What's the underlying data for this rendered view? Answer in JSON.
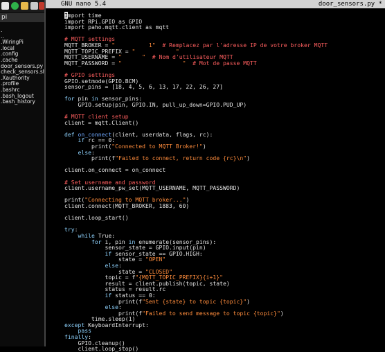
{
  "file_manager": {
    "location": "pi",
    "files": [
      ".",
      "..",
      ".WiringPi",
      ".local",
      ".config",
      ".cache",
      "door_sensors.py",
      "check_sensors.sh",
      ".Xauthority",
      ".profile",
      ".bashrc",
      ".bash_logout",
      ".bash_history"
    ]
  },
  "nano": {
    "version": "GNU nano 5.4",
    "filename": "door_sensors.py *"
  },
  "code_lines": [
    [
      [
        "t",
        "I"
      ],
      [
        "t",
        "mport time"
      ]
    ],
    [
      [
        "t",
        "import RPi.GPIO as GPIO"
      ]
    ],
    [
      [
        "t",
        "import paho.mqtt.client as mqtt"
      ]
    ],
    [
      [
        "t",
        ""
      ]
    ],
    [
      [
        "cm",
        "# MQTT settings"
      ]
    ],
    [
      [
        "t",
        "MQTT_BROKER = "
      ],
      [
        "st",
        "\""
      ],
      [
        "red",
        "          "
      ],
      [
        "st",
        "1\""
      ],
      [
        "cm",
        "  # Remplacez par l'adresse IP de votre broker MQTT"
      ]
    ],
    [
      [
        "t",
        "MQTT_TOPIC_PREFIX = "
      ],
      [
        "st",
        "\""
      ],
      [
        "red",
        "            "
      ],
      [
        "st",
        "\""
      ]
    ],
    [
      [
        "t",
        "MQTT_USERNAME = "
      ],
      [
        "st",
        "\""
      ],
      [
        "red",
        "      "
      ],
      [
        "st",
        "\""
      ],
      [
        "cm",
        "  # Nom d'utilisateur MQTT"
      ]
    ],
    [
      [
        "t",
        "MQTT_PASSWORD = "
      ],
      [
        "st",
        "\""
      ],
      [
        "red",
        "                  "
      ],
      [
        "st",
        "\""
      ],
      [
        "cm",
        "  # Mot de passe MQTT"
      ]
    ],
    [
      [
        "t",
        ""
      ]
    ],
    [
      [
        "cm",
        "# GPIO settings"
      ]
    ],
    [
      [
        "t",
        "GPIO.setmode(GPIO.BCM)"
      ]
    ],
    [
      [
        "t",
        "sensor_pins = [18, 4, 5, 6, 13, 17, 22, 26, 27]"
      ]
    ],
    [
      [
        "t",
        ""
      ]
    ],
    [
      [
        "kw",
        "for"
      ],
      [
        "t",
        " pin "
      ],
      [
        "kw",
        "in"
      ],
      [
        "t",
        " sensor_pins:"
      ]
    ],
    [
      [
        "t",
        "    GPIO.setup(pin, GPIO.IN, pull_up_down=GPIO.PUD_UP)"
      ]
    ],
    [
      [
        "t",
        ""
      ]
    ],
    [
      [
        "cm",
        "# MQTT client setup"
      ]
    ],
    [
      [
        "t",
        "client = mqtt.Client()"
      ]
    ],
    [
      [
        "t",
        ""
      ]
    ],
    [
      [
        "kw",
        "def"
      ],
      [
        "t",
        " "
      ],
      [
        "fn",
        "on_connect"
      ],
      [
        "t",
        "(client, userdata, flags, rc):"
      ]
    ],
    [
      [
        "t",
        "    "
      ],
      [
        "kw",
        "if"
      ],
      [
        "t",
        " rc == 0:"
      ]
    ],
    [
      [
        "t",
        "        print("
      ],
      [
        "st",
        "\"Connected to MQTT Broker!\""
      ],
      [
        "t",
        ")"
      ]
    ],
    [
      [
        "t",
        "    "
      ],
      [
        "kw",
        "else"
      ],
      [
        "t",
        ":"
      ]
    ],
    [
      [
        "t",
        "        print(f"
      ],
      [
        "st",
        "\"Failed to connect, return code {rc}\\n\""
      ],
      [
        "t",
        ")"
      ]
    ],
    [
      [
        "t",
        ""
      ]
    ],
    [
      [
        "t",
        "client.on_connect = on_connect"
      ]
    ],
    [
      [
        "t",
        ""
      ]
    ],
    [
      [
        "cm",
        "# Set username and password"
      ]
    ],
    [
      [
        "t",
        "client.username_pw_set(MQTT_USERNAME, MQTT_PASSWORD)"
      ]
    ],
    [
      [
        "t",
        ""
      ]
    ],
    [
      [
        "t",
        "print("
      ],
      [
        "st",
        "\"Connecting to MQTT broker...\""
      ],
      [
        "t",
        ")"
      ]
    ],
    [
      [
        "t",
        "client.connect(MQTT_BROKER, 1883, 60)"
      ]
    ],
    [
      [
        "t",
        ""
      ]
    ],
    [
      [
        "t",
        "client.loop_start()"
      ]
    ],
    [
      [
        "t",
        ""
      ]
    ],
    [
      [
        "kw",
        "try"
      ],
      [
        "t",
        ":"
      ]
    ],
    [
      [
        "t",
        "    "
      ],
      [
        "kw",
        "while"
      ],
      [
        "t",
        " True:"
      ]
    ],
    [
      [
        "t",
        "        "
      ],
      [
        "kw",
        "for"
      ],
      [
        "t",
        " i, pin "
      ],
      [
        "kw",
        "in"
      ],
      [
        "t",
        " enumerate(sensor_pins):"
      ]
    ],
    [
      [
        "t",
        "            sensor_state = GPIO.input(pin)"
      ]
    ],
    [
      [
        "t",
        "            "
      ],
      [
        "kw",
        "if"
      ],
      [
        "t",
        " sensor_state == GPIO.HIGH:"
      ]
    ],
    [
      [
        "t",
        "                state = "
      ],
      [
        "st",
        "\"OPEN\""
      ]
    ],
    [
      [
        "t",
        "            "
      ],
      [
        "kw",
        "else"
      ],
      [
        "t",
        ":"
      ]
    ],
    [
      [
        "t",
        "                state = "
      ],
      [
        "st",
        "\"CLOSED\""
      ]
    ],
    [
      [
        "t",
        "            topic = f"
      ],
      [
        "st",
        "\"{MQTT_TOPIC_PREFIX}{i+1}\""
      ]
    ],
    [
      [
        "t",
        "            result = client.publish(topic, state)"
      ]
    ],
    [
      [
        "t",
        "            status = result.rc"
      ]
    ],
    [
      [
        "t",
        "            "
      ],
      [
        "kw",
        "if"
      ],
      [
        "t",
        " status == 0:"
      ]
    ],
    [
      [
        "t",
        "                print(f"
      ],
      [
        "st",
        "\"Sent {state} to topic {topic}\""
      ],
      [
        "t",
        ")"
      ]
    ],
    [
      [
        "t",
        "            "
      ],
      [
        "kw",
        "else"
      ],
      [
        "t",
        ":"
      ]
    ],
    [
      [
        "t",
        "                print(f"
      ],
      [
        "st",
        "\"Failed to send message to topic {topic}\""
      ],
      [
        "t",
        ")"
      ]
    ],
    [
      [
        "t",
        "        time.sleep(1)"
      ]
    ],
    [
      [
        "kw",
        "except"
      ],
      [
        "t",
        " KeyboardInterrupt:"
      ]
    ],
    [
      [
        "t",
        "    "
      ],
      [
        "kw",
        "pass"
      ]
    ],
    [
      [
        "kw",
        "finally"
      ],
      [
        "t",
        ":"
      ]
    ],
    [
      [
        "t",
        "    GPIO.cleanup()"
      ]
    ],
    [
      [
        "t",
        "    client.loop_stop()"
      ]
    ]
  ]
}
